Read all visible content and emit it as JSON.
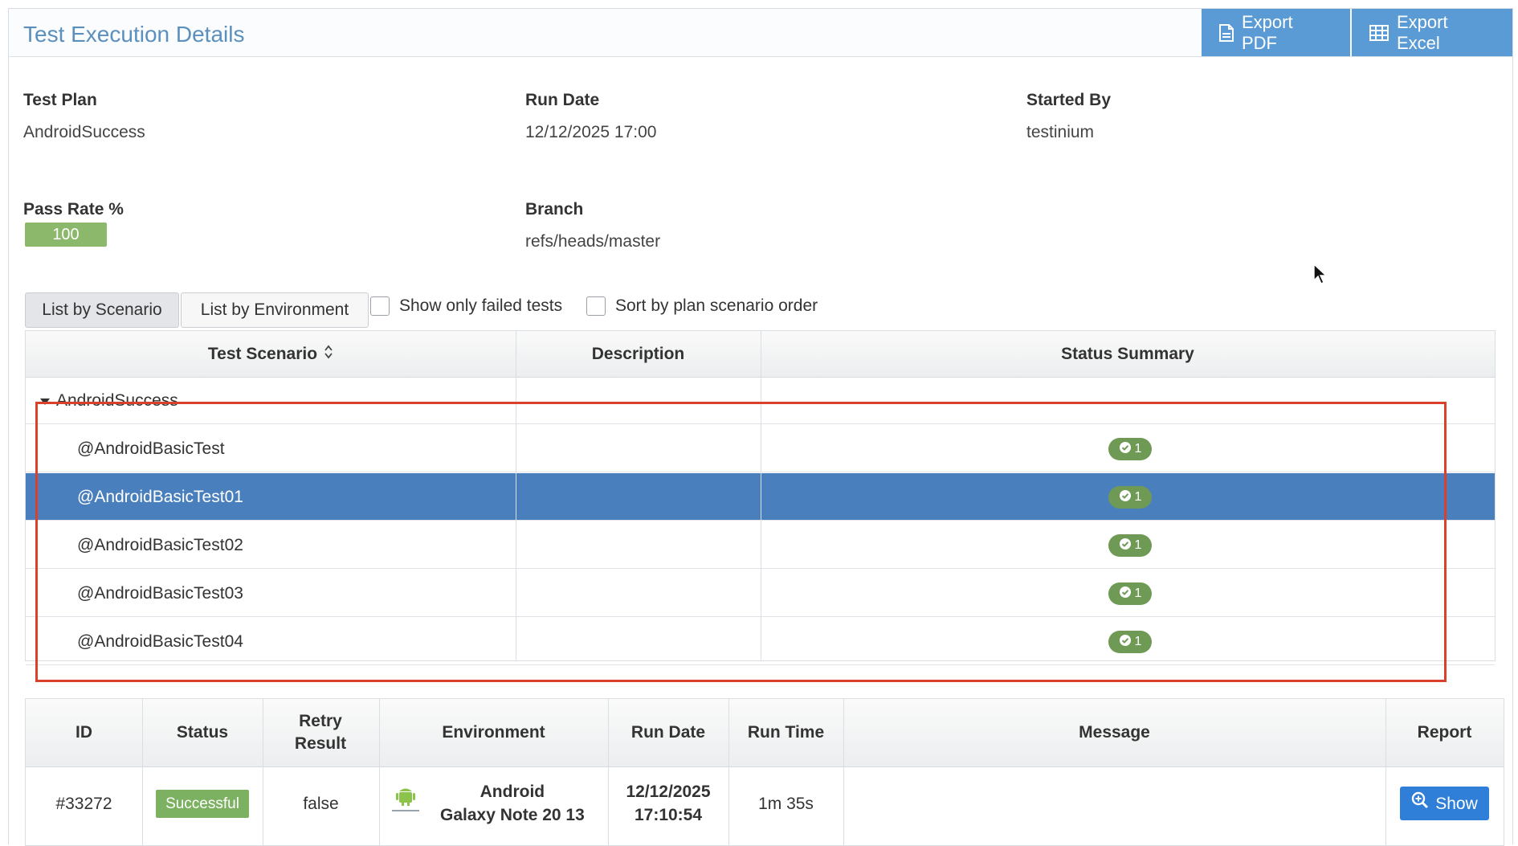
{
  "header": {
    "title": "Test Execution Details",
    "export_pdf": "Export PDF",
    "export_excel": "Export Excel"
  },
  "details": {
    "test_plan_label": "Test Plan",
    "test_plan_value": "AndroidSuccess",
    "run_date_label": "Run Date",
    "run_date_value": "12/12/2025 17:00",
    "started_by_label": "Started By",
    "started_by_value": "testinium",
    "pass_rate_label": "Pass Rate %",
    "pass_rate_value": "100",
    "branch_label": "Branch",
    "branch_value": "refs/heads/master"
  },
  "toolbar": {
    "tab_scenario": "List by Scenario",
    "tab_environment": "List by Environment",
    "show_failed": "Show only failed tests",
    "sort_plan": "Sort by plan scenario order"
  },
  "scenario_table": {
    "columns": [
      "Test Scenario",
      "Description",
      "Status Summary"
    ],
    "group": "AndroidSuccess",
    "rows": [
      {
        "name": "@AndroidBasicTest",
        "count": "1"
      },
      {
        "name": "@AndroidBasicTest01",
        "count": "1"
      },
      {
        "name": "@AndroidBasicTest02",
        "count": "1"
      },
      {
        "name": "@AndroidBasicTest03",
        "count": "1"
      },
      {
        "name": "@AndroidBasicTest04",
        "count": "1"
      }
    ],
    "selected_index": 1
  },
  "run_table": {
    "columns": [
      "ID",
      "Status",
      "Retry Result",
      "Environment",
      "Run Date",
      "Run Time",
      "Message",
      "Report"
    ],
    "row": {
      "id": "#33272",
      "status": "Successful",
      "retry": "false",
      "env_line1": "Android",
      "env_line2": "Galaxy Note 20 13",
      "date_line1": "12/12/2025",
      "date_line2": "17:10:54",
      "run_time": "1m 35s",
      "message": "",
      "report_button": "Show"
    }
  },
  "colors": {
    "accent": "#5b9bd5",
    "selected_row": "#4a7fbd",
    "success": "#7cb162",
    "highlight_box": "#d9412a"
  }
}
